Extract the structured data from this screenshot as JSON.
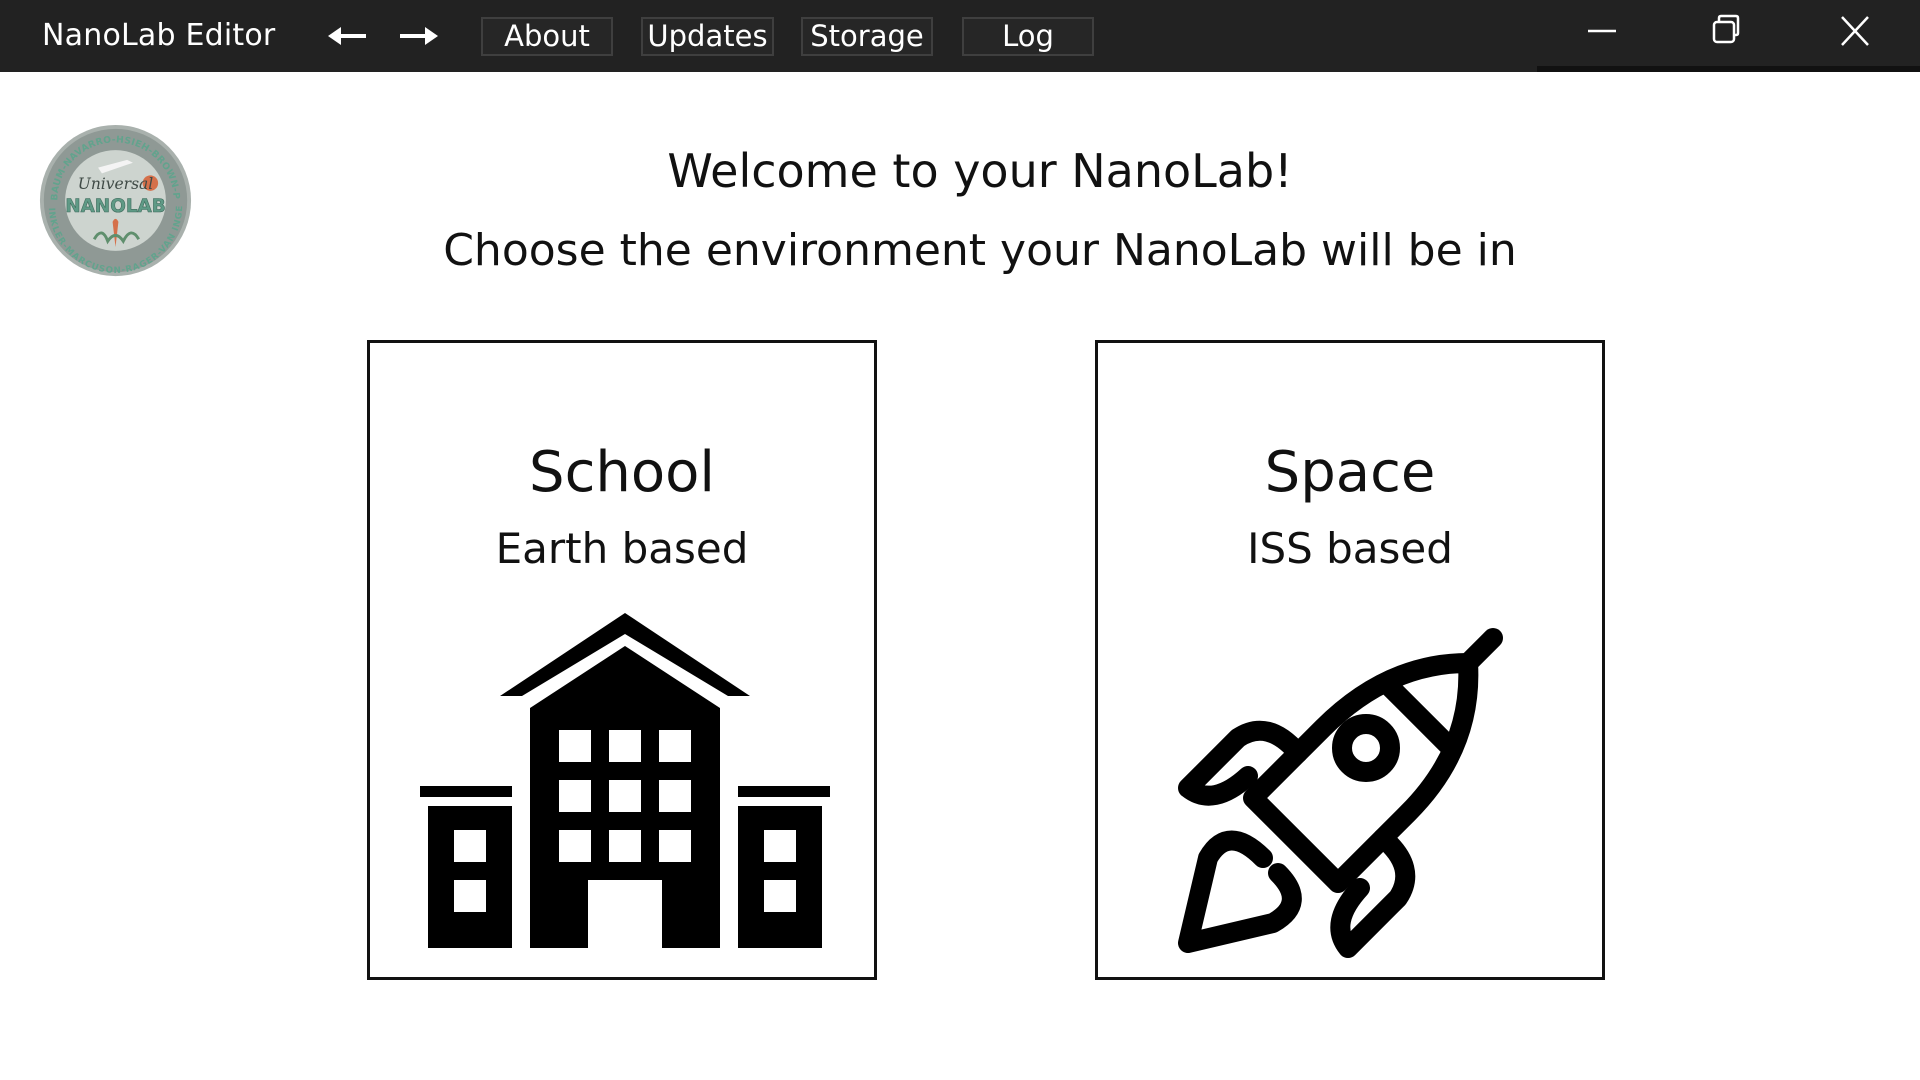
{
  "window": {
    "title": "NanoLab Editor",
    "menu": [
      {
        "id": "about",
        "label": "About"
      },
      {
        "id": "updates",
        "label": "Updates"
      },
      {
        "id": "storage",
        "label": "Storage"
      },
      {
        "id": "log",
        "label": "Log"
      }
    ],
    "icons": {
      "back": "arrow-left-icon",
      "forward": "arrow-right-icon",
      "minimize": "minimize-icon",
      "restore": "restore-icon",
      "close": "close-icon"
    }
  },
  "logo": {
    "top_text": "TEITELBAUM-NAVARRO-HSIEH-BROWN-POWELL",
    "bottom_text": "WINKLER-MARCUSON-RAGER-VAN INGEN",
    "script_text": "Universal",
    "main_text": "NANOLAB"
  },
  "main": {
    "welcome": "Welcome to your NanoLab!",
    "prompt": "Choose the environment your NanoLab will be in"
  },
  "options": {
    "school": {
      "title": "School",
      "subtitle": "Earth based",
      "icon": "school-building-icon"
    },
    "space": {
      "title": "Space",
      "subtitle": "ISS based",
      "icon": "rocket-icon"
    }
  },
  "colors": {
    "titlebar_bg": "#222222",
    "titlebar_text": "#ffffff",
    "page_bg": "#ffffff",
    "text": "#111111",
    "logo_ring": "#8a9b94",
    "logo_text": "#5f9a86"
  }
}
